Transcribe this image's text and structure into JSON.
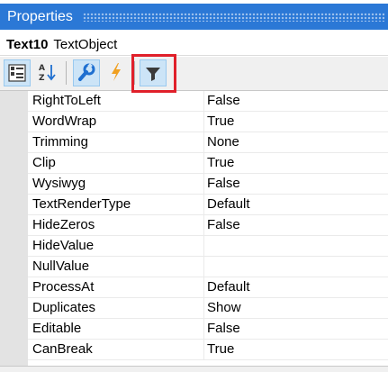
{
  "window": {
    "title": "Properties"
  },
  "object": {
    "name": "Text10",
    "type": "TextObject"
  },
  "toolbar": {
    "buttons": [
      {
        "icon": "categorized-icon",
        "active": true
      },
      {
        "icon": "sort-alphabetical-icon",
        "active": false
      },
      {
        "icon": "wrench-icon",
        "active": true
      },
      {
        "icon": "lightning-icon",
        "active": false
      },
      {
        "icon": "filter-icon",
        "active": true
      }
    ]
  },
  "colors": {
    "titlebar": "#2b78d6",
    "highlight": "#e0202a",
    "active_button": "#cce4f7",
    "icon_blue": "#1e6fd0",
    "lightning": "#f0a020"
  },
  "properties": [
    {
      "name": "RightToLeft",
      "value": "False"
    },
    {
      "name": "WordWrap",
      "value": "True"
    },
    {
      "name": "Trimming",
      "value": "None"
    },
    {
      "name": "Clip",
      "value": "True"
    },
    {
      "name": "Wysiwyg",
      "value": "False"
    },
    {
      "name": "TextRenderType",
      "value": "Default"
    },
    {
      "name": "HideZeros",
      "value": "False"
    },
    {
      "name": "HideValue",
      "value": ""
    },
    {
      "name": "NullValue",
      "value": ""
    },
    {
      "name": "ProcessAt",
      "value": "Default"
    },
    {
      "name": "Duplicates",
      "value": "Show"
    },
    {
      "name": "Editable",
      "value": "False"
    },
    {
      "name": "CanBreak",
      "value": "True"
    }
  ]
}
